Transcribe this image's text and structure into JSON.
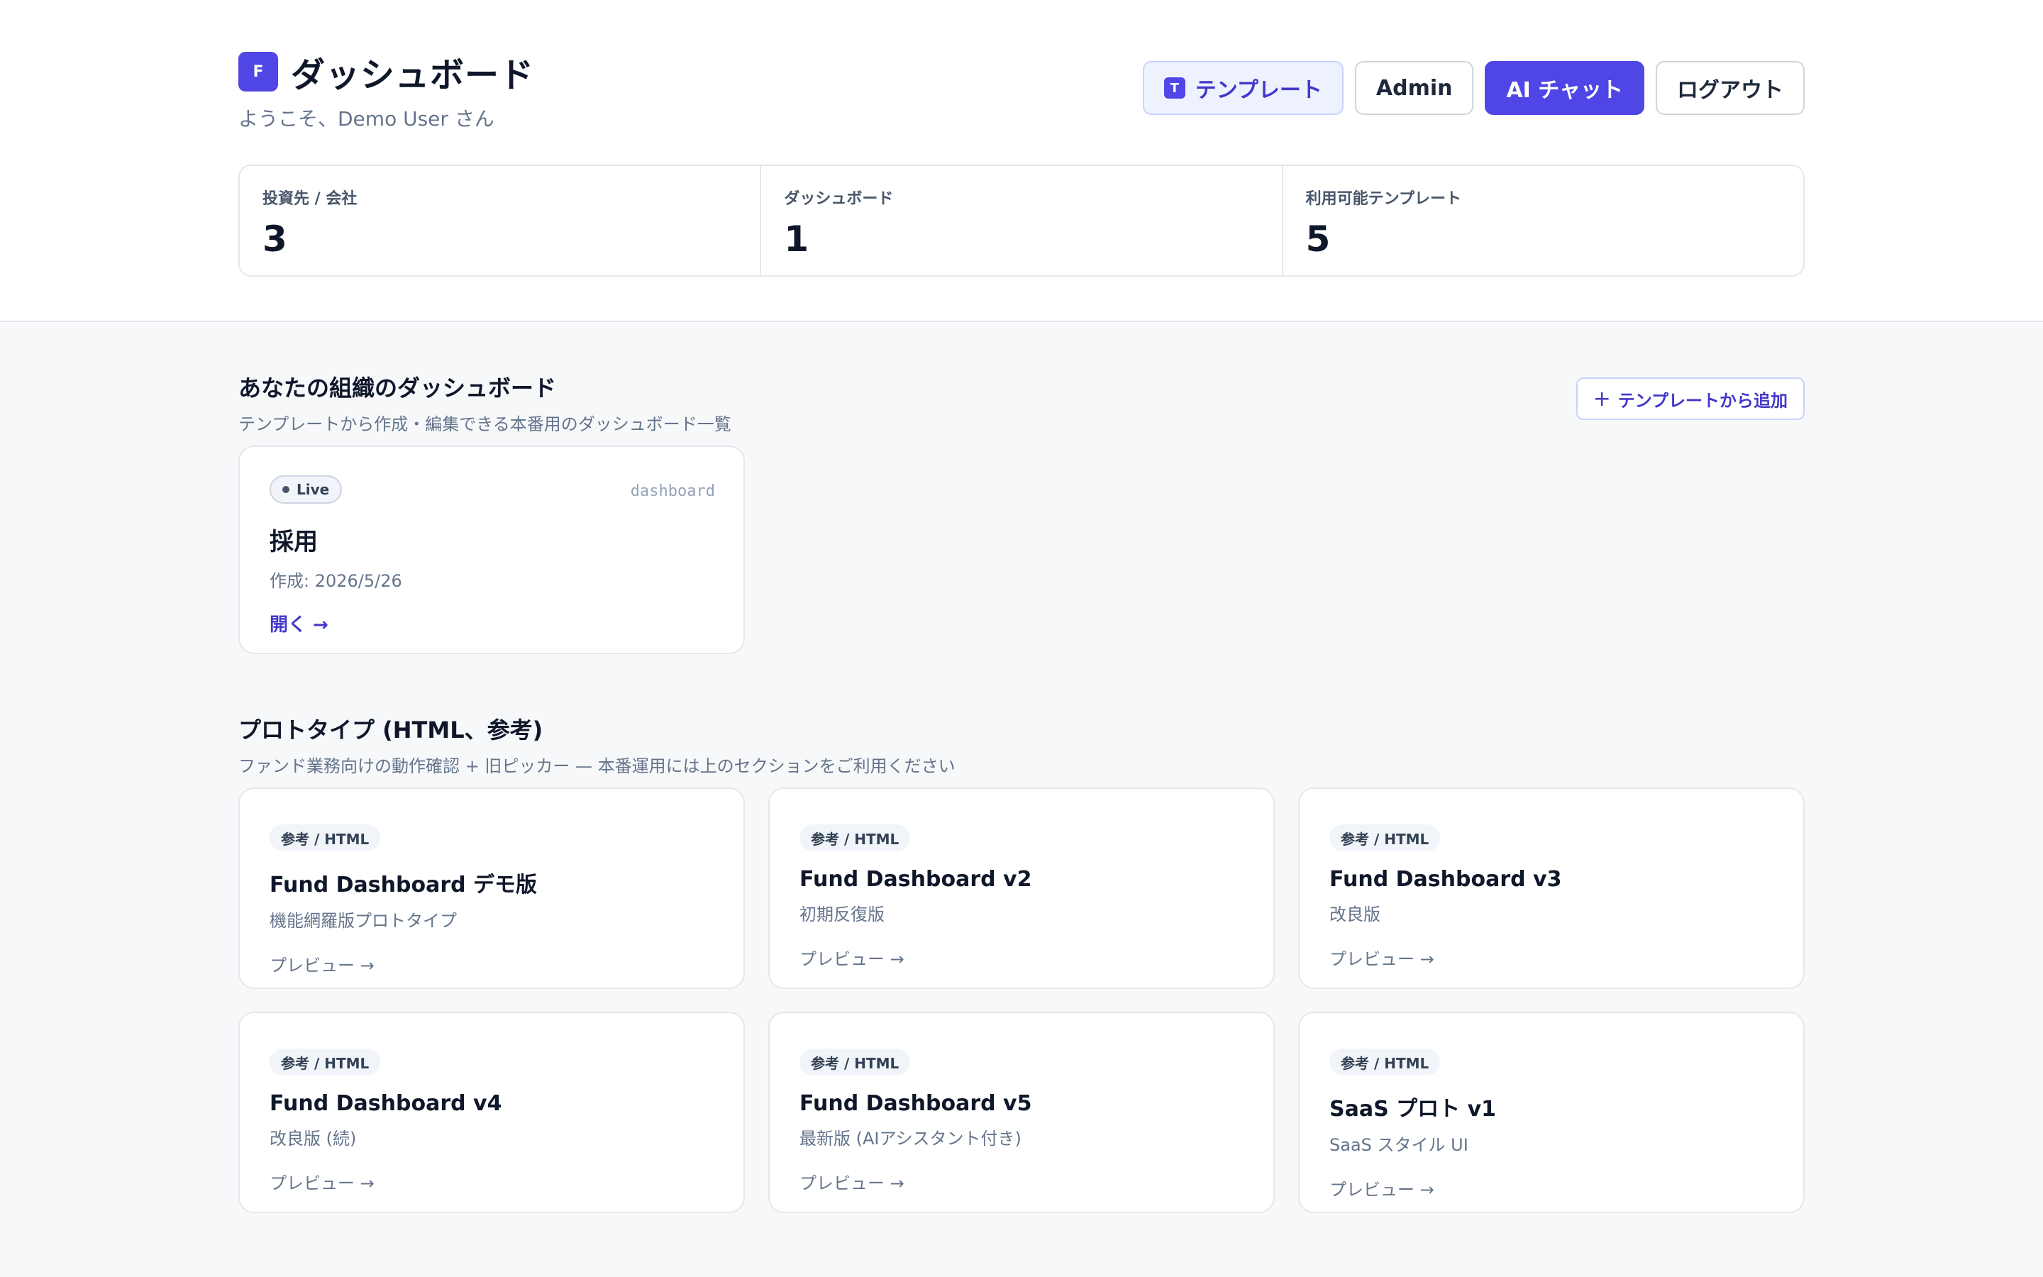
{
  "header": {
    "logo_letter": "F",
    "title": "ダッシュボード",
    "welcome": "ようこそ、Demo User さん"
  },
  "nav": {
    "template_badge": "T",
    "template": "テンプレート",
    "admin": "Admin",
    "ai_chat": "AI チャット",
    "logout": "ログアウト"
  },
  "stats": [
    {
      "label": "投資先 / 会社",
      "value": "3"
    },
    {
      "label": "ダッシュボード",
      "value": "1"
    },
    {
      "label": "利用可能テンプレート",
      "value": "5"
    }
  ],
  "org_section": {
    "title": "あなたの組織のダッシュボード",
    "subtitle": "テンプレートから作成・編集できる本番用のダッシュボード一覧",
    "add_button": "テンプレートから追加",
    "add_icon": "+"
  },
  "dashboards": [
    {
      "status": "Live",
      "kind": "dashboard",
      "name": "採用",
      "created": "作成: 2026/5/26",
      "open_label": "開く →"
    }
  ],
  "proto_section": {
    "title": "プロトタイプ (HTML、参考)",
    "subtitle": "ファンド業務向けの動作確認 + 旧ピッカー — 本番運用には上のセクションをご利用ください"
  },
  "prototypes": [
    {
      "badge": "参考 / HTML",
      "name": "Fund Dashboard デモ版",
      "desc": "機能網羅版プロトタイプ",
      "preview": "プレビュー →"
    },
    {
      "badge": "参考 / HTML",
      "name": "Fund Dashboard v2",
      "desc": "初期反復版",
      "preview": "プレビュー →"
    },
    {
      "badge": "参考 / HTML",
      "name": "Fund Dashboard v3",
      "desc": "改良版",
      "preview": "プレビュー →"
    },
    {
      "badge": "参考 / HTML",
      "name": "Fund Dashboard v4",
      "desc": "改良版 (続)",
      "preview": "プレビュー →"
    },
    {
      "badge": "参考 / HTML",
      "name": "Fund Dashboard v5",
      "desc": "最新版 (AIアシスタント付き)",
      "preview": "プレビュー →"
    },
    {
      "badge": "参考 / HTML",
      "name": "SaaS プロト v1",
      "desc": "SaaS スタイル UI",
      "preview": "プレビュー →"
    }
  ],
  "colors": {
    "accent": "#4f46e5",
    "accent_text": "#4338ca",
    "muted_text": "#64748b",
    "page_bg": "#f7f8fa"
  }
}
